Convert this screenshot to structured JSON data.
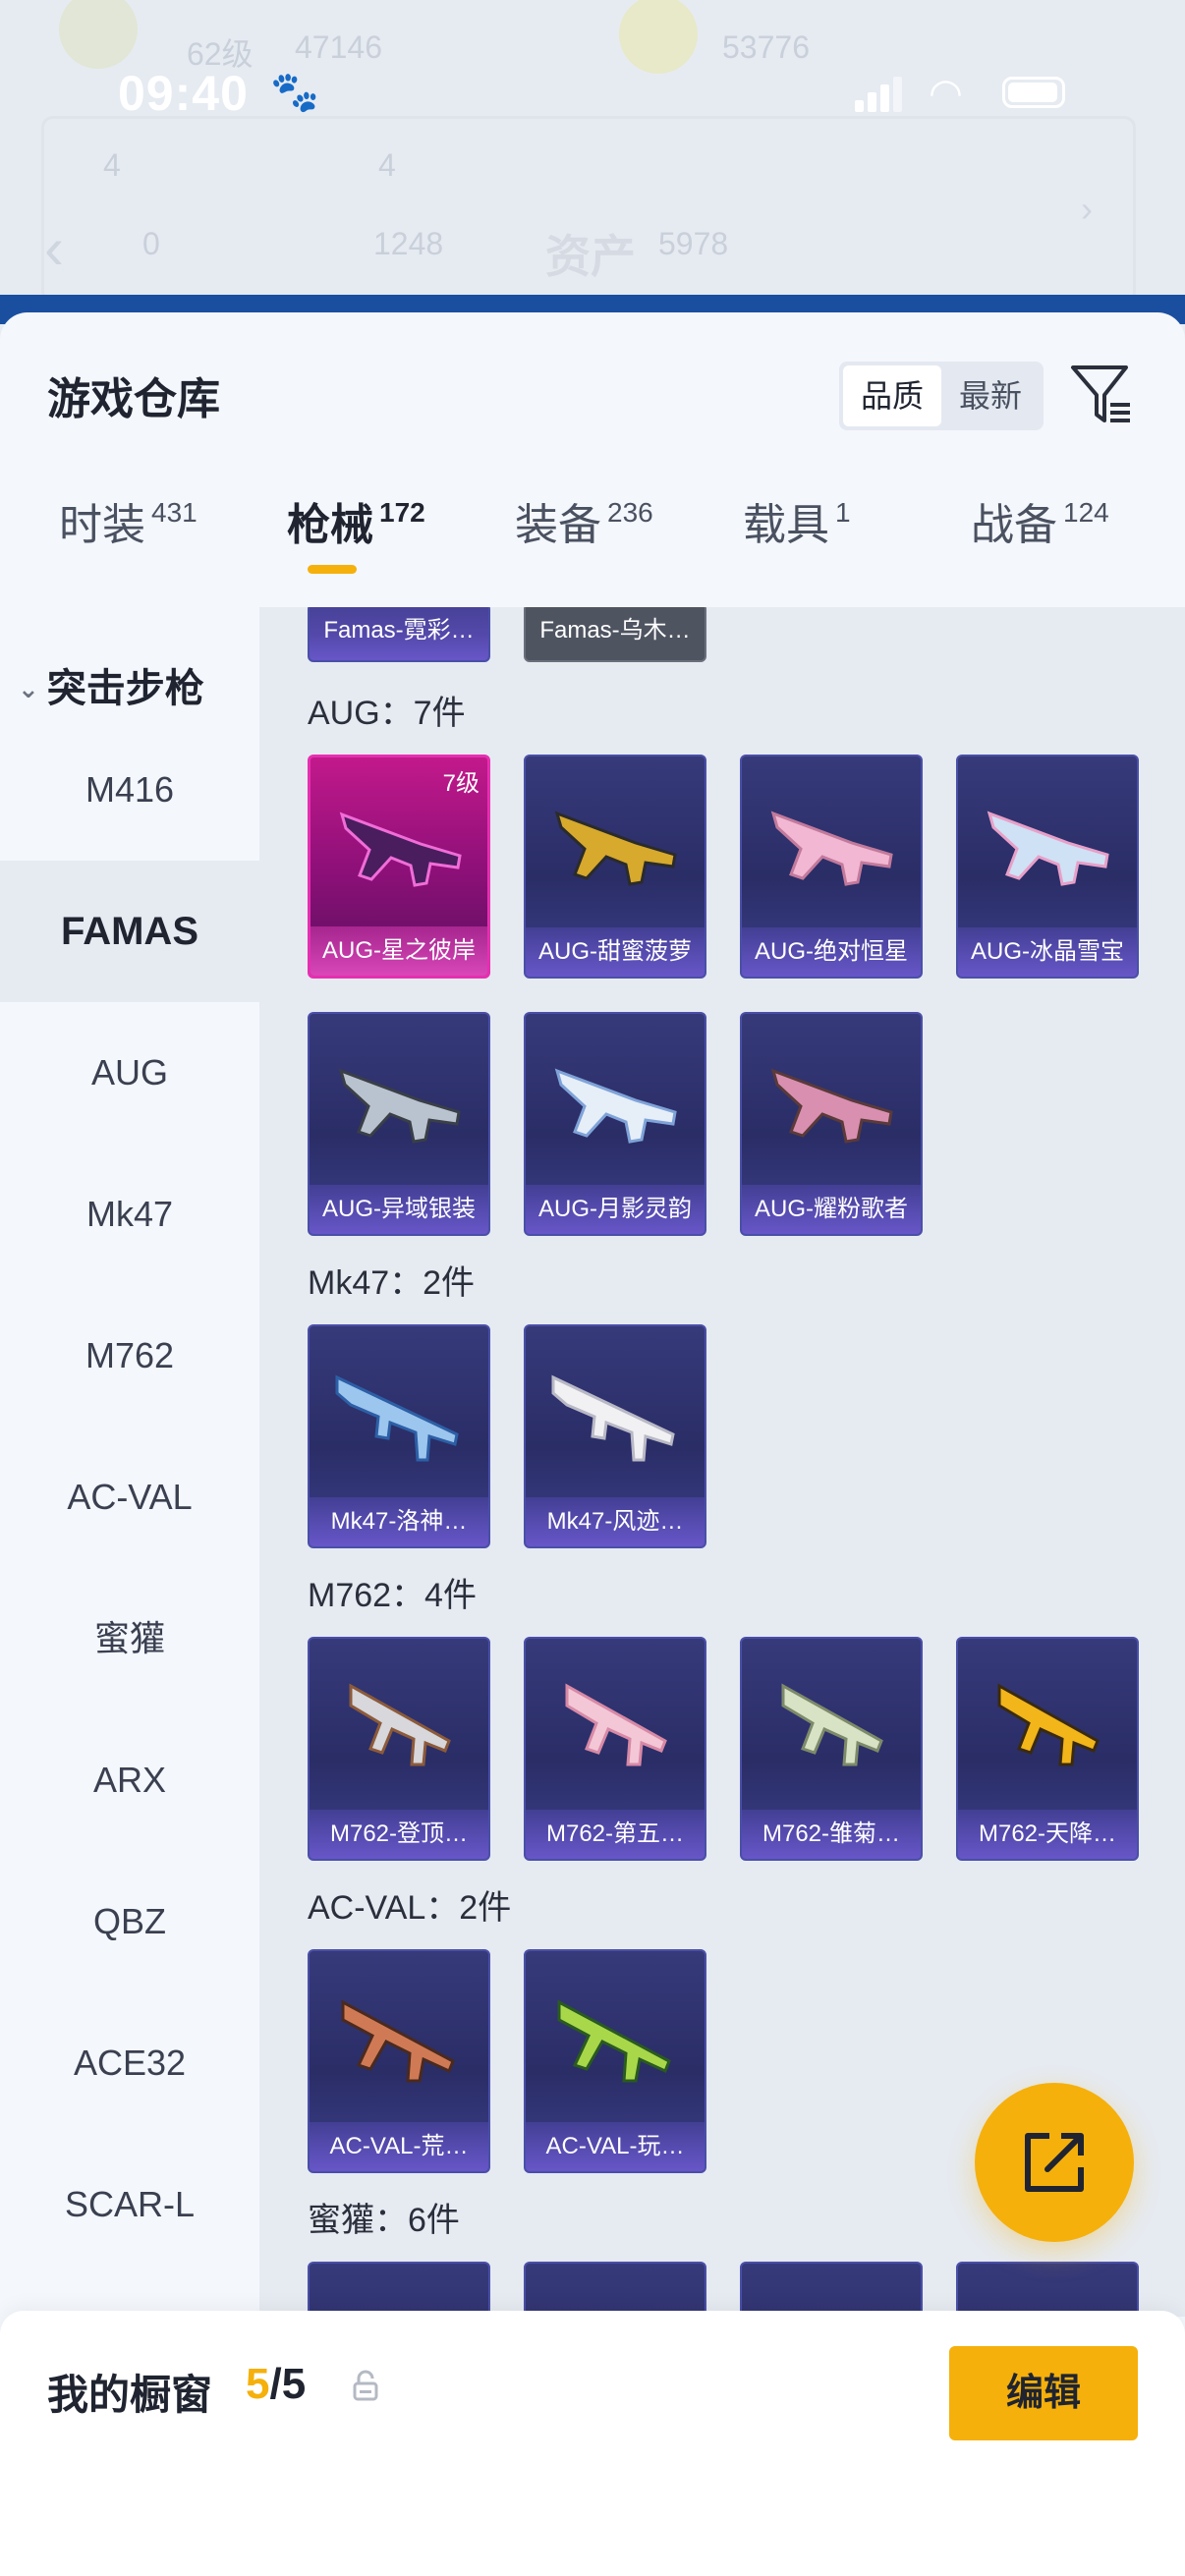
{
  "status_bar": {
    "time": "09:40"
  },
  "background": {
    "ghost_1": "62级",
    "ghost_2": "47146",
    "ghost_3": "53776",
    "ghost_4": "4",
    "ghost_5": "4",
    "ghost_6": "资产",
    "ghost_7": "1248",
    "ghost_8": "5978",
    "ghost_9": "0"
  },
  "header": {
    "title": "游戏仓库",
    "sort_options": [
      "品质",
      "最新"
    ],
    "sort_selected": "品质"
  },
  "tabs": [
    {
      "label": "时装",
      "count": "431"
    },
    {
      "label": "枪械",
      "count": "172"
    },
    {
      "label": "装备",
      "count": "236"
    },
    {
      "label": "载具",
      "count": "1"
    },
    {
      "label": "战备",
      "count": "124"
    }
  ],
  "sidebar": {
    "category": "突击步枪",
    "items": [
      "M416",
      "FAMAS",
      "AUG",
      "Mk47",
      "M762",
      "AC-VAL",
      "蜜獾",
      "ARX",
      "QBZ",
      "ACE32",
      "SCAR-L"
    ],
    "active": "FAMAS"
  },
  "content": {
    "top_partial": [
      "Famas-霓彩…",
      "Famas-乌木…"
    ],
    "sections": [
      {
        "title": "AUG：7件",
        "items": [
          "AUG-星之彼岸",
          "AUG-甜蜜菠萝",
          "AUG-绝对恒星",
          "AUG-冰晶雪宝",
          "AUG-异域银装",
          "AUG-月影灵韵",
          "AUG-耀粉歌者"
        ],
        "level_badge": "7级"
      },
      {
        "title": "Mk47：2件",
        "items": [
          "Mk47-洛神…",
          "Mk47-风迹…"
        ]
      },
      {
        "title": "M762：4件",
        "items": [
          "M762-登顶…",
          "M762-第五…",
          "M762-雏菊…",
          "M762-天降…"
        ]
      },
      {
        "title": "AC-VAL：2件",
        "items": [
          "AC-VAL-荒…",
          "AC-VAL-玩…"
        ]
      },
      {
        "title": "蜜獾：6件",
        "items": []
      }
    ]
  },
  "bottom": {
    "title": "我的橱窗",
    "current": "5",
    "total": "/5",
    "edit_label": "编辑"
  },
  "colors": {
    "accent": "#f5b00b",
    "card_bg": "#2f3270",
    "card_pink": "#c2198b"
  }
}
